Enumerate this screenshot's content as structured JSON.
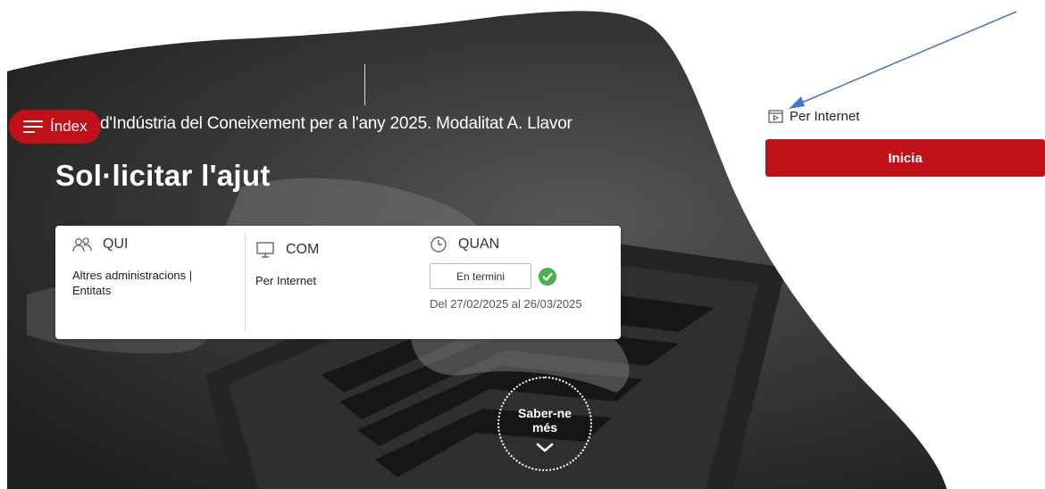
{
  "hero": {
    "index_label": "Índex",
    "procedure_title": "d'Indústria del Coneixement per a l'any 2025. Modalitat A. Llavor",
    "page_title": "Sol·licitar l'ajut",
    "more_label_line1": "Saber-ne",
    "more_label_line2": "més"
  },
  "info_card": {
    "qui": {
      "heading": "QUI",
      "text": "Altres administracions | Entitats"
    },
    "com": {
      "heading": "COM",
      "text": "Per Internet"
    },
    "quan": {
      "heading": "QUAN",
      "status": "En termini",
      "dates": "Del 27/02/2025 al 26/03/2025"
    }
  },
  "sidebar": {
    "channel_label": "Per Internet",
    "start_button": "Inicia"
  },
  "colors": {
    "accent_red": "#c0111a",
    "status_green": "#4cb050",
    "annotation_arrow": "#4a77c4"
  },
  "icons": [
    "menu-icon",
    "users-icon",
    "monitor-icon",
    "clock-icon",
    "check-circle-icon",
    "chevron-down-icon",
    "internet-window-icon"
  ]
}
